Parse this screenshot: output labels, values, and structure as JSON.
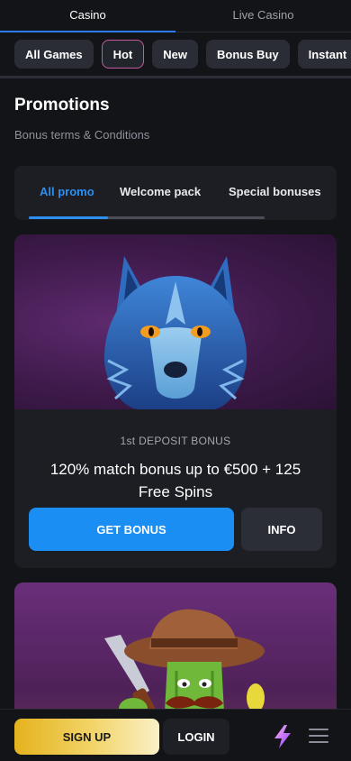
{
  "top_tabs": [
    {
      "label": "Casino",
      "active": true
    },
    {
      "label": "Live Casino",
      "active": false
    }
  ],
  "categories": [
    "All Games",
    "Hot",
    "New",
    "Bonus Buy",
    "Instant"
  ],
  "page": {
    "title": "Promotions",
    "terms_link": "Bonus terms & Conditions"
  },
  "promo_tabs": [
    "All promo",
    "Welcome pack",
    "Special bonuses"
  ],
  "promos": [
    {
      "subtitle": "1st DEPOSIT BONUS",
      "headline": "120% match bonus up to €500 + 125 Free Spins",
      "cta": "GET BONUS",
      "info": "INFO",
      "image": "wolf"
    },
    {
      "image": "cactus-cowboy"
    }
  ],
  "bottom_bar": {
    "signup": "SIGN UP",
    "login": "LOGIN",
    "bolt_icon": "lightning-icon",
    "menu_icon": "hamburger-menu-icon"
  },
  "colors": {
    "accent_blue": "#1a8ef2",
    "signup_gold": "#e4b21e",
    "background": "#131417",
    "card": "#1c1e23",
    "hot_border": "#c65aa0"
  }
}
